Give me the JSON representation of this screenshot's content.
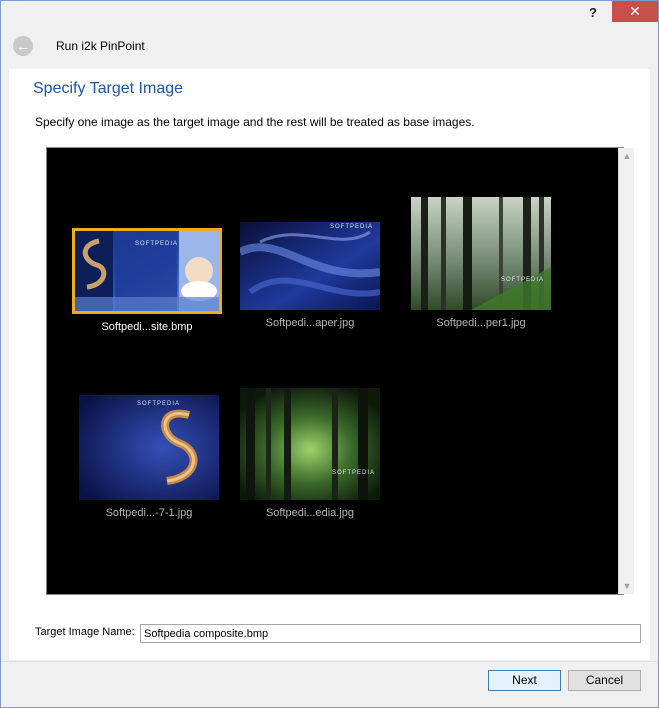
{
  "window": {
    "help_glyph": "?",
    "close_glyph": "✕"
  },
  "header": {
    "back_glyph": "←",
    "title": "Run i2k PinPoint"
  },
  "content": {
    "heading": "Specify Target Image",
    "instructions": "Specify one image as the target image and the rest will be treated as base images."
  },
  "gallery": {
    "items": [
      {
        "label": "Softpedi...site.bmp",
        "selected": true,
        "overlay": "SOFTPEDIA"
      },
      {
        "label": "Softpedi...aper.jpg",
        "selected": false,
        "overlay": "SOFTPEDIA"
      },
      {
        "label": "Softpedi...per1.jpg",
        "selected": false,
        "overlay": "SOFTPEDIA"
      },
      {
        "label": "Softpedi...-7-1.jpg",
        "selected": false,
        "overlay": "SOFTPEDIA"
      },
      {
        "label": "Softpedi...edia.jpg",
        "selected": false,
        "overlay": "SOFTPEDIA"
      }
    ],
    "scroll_up_glyph": "▲",
    "scroll_down_glyph": "▼"
  },
  "target": {
    "label": "Target Image Name:",
    "value": "Softpedia composite.bmp"
  },
  "footer": {
    "next_label": "Next",
    "cancel_label": "Cancel"
  },
  "colors": {
    "selection_border": "#f3aa1c",
    "heading": "#1e55a6",
    "close_button": "#c7504c"
  }
}
